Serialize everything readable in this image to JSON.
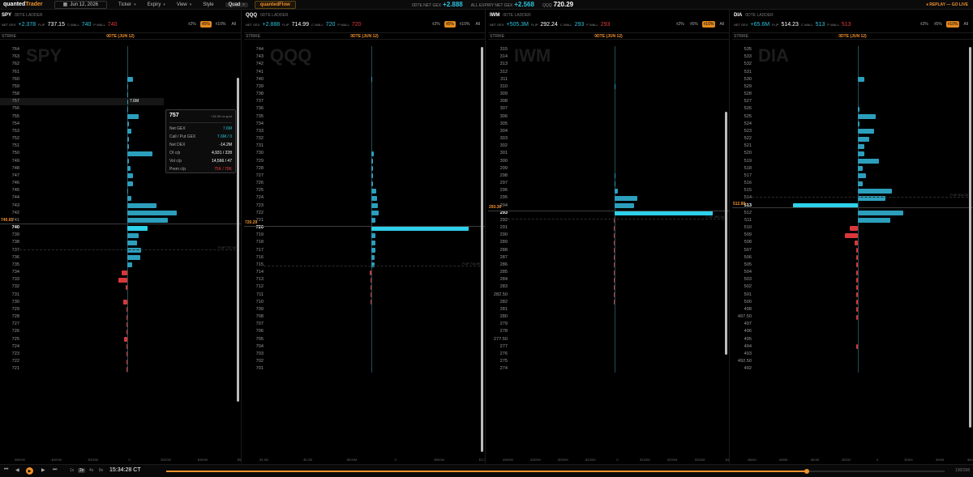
{
  "app": {
    "logo_main": "quanted",
    "logo_accent": "Trader",
    "date": "Jun 12, 2026",
    "menus": [
      "Ticker",
      "Expiry",
      "View",
      "Style"
    ],
    "layout_value": "Quad",
    "flow_button": "quantedFlow",
    "odte_label": "0DTE NET GEX",
    "odte_value": "+2.888",
    "all_label": "ALL EXPIRY NET GEX",
    "all_value": "+2.568",
    "qqq_label": "QQQ",
    "qqq_value": "720.29",
    "replay": "REPLAY — GO LIVE"
  },
  "common": {
    "subtitle": "0DTE LADDER",
    "netgex_label": "NET GEX",
    "flip_label": "FLIP",
    "cwall_label": "C WALL",
    "pwall_label": "P WALL",
    "ranges": [
      "±2%",
      "±5%",
      "±10%",
      "All"
    ],
    "strike_header": "STRIKE",
    "dte_header": "0DTE (JUN 12)"
  },
  "panels": [
    {
      "ticker": "SPY",
      "net_gex": "+2.378",
      "flip": "737.15",
      "cwall": "740",
      "pwall": "740",
      "range_sel": 1,
      "spot": 740.65,
      "spot_label": "740.65",
      "atm": 740,
      "flip_val": 737.15,
      "flip_text": "FLIP 737.15",
      "max": 500,
      "axis": [
        "-$500M",
        "-$400M",
        "-$200M",
        "0",
        "$200M",
        "$400M",
        "$5"
      ],
      "strikes": [
        764,
        763,
        762,
        761,
        760,
        759,
        758,
        757,
        756,
        755,
        754,
        753,
        752,
        751,
        750,
        749,
        748,
        747,
        746,
        745,
        744,
        743,
        742,
        741,
        740,
        739,
        738,
        737,
        736,
        735,
        734,
        733,
        732,
        731,
        730,
        729,
        728,
        727,
        726,
        725,
        724,
        723,
        722,
        721
      ],
      "gex": [
        0,
        0,
        0,
        0,
        30,
        5,
        5,
        5,
        5,
        60,
        8,
        20,
        10,
        8,
        130,
        10,
        15,
        30,
        30,
        5,
        20,
        150,
        255,
        210,
        105,
        60,
        50,
        70,
        65,
        25,
        -30,
        -45,
        -10,
        0,
        -20,
        -5,
        -3,
        -3,
        -3,
        -15,
        -3,
        -3,
        -2,
        -2
      ],
      "bar_label": {
        "strike": 757,
        "text": "7.6M"
      }
    },
    {
      "ticker": "QQQ",
      "net_gex": "+2.888",
      "flip": "714.99",
      "cwall": "720",
      "pwall": "720",
      "range_sel": 1,
      "spot": 720.29,
      "spot_label": "720.29",
      "atm": 720,
      "flip_val": 714.99,
      "flip_text": "FLIP 714.99",
      "max": 1.2,
      "axis": [
        "-$1.5B",
        "-$1.0B",
        "-$500M",
        "0",
        "$500M",
        "$1.0B"
      ],
      "strikes": [
        744,
        743,
        742,
        741,
        740,
        739,
        738,
        737,
        736,
        735,
        734,
        733,
        732,
        731,
        730,
        729,
        728,
        727,
        726,
        725,
        724,
        723,
        722,
        721,
        720,
        719,
        718,
        717,
        716,
        715,
        714,
        713,
        712,
        711,
        710,
        709,
        708,
        707,
        706,
        705,
        704,
        703,
        702,
        701
      ],
      "gex": [
        0,
        0,
        0,
        0,
        0.01,
        0,
        0,
        0,
        0,
        0,
        0,
        0,
        0,
        0,
        0.03,
        0.02,
        0.02,
        0.02,
        0.02,
        0.06,
        0.07,
        0.08,
        0.09,
        0.05,
        1.2,
        0.05,
        0.05,
        0.05,
        0.04,
        0.04,
        -0.02,
        -0.01,
        -0.01,
        -0.01,
        -0.01,
        0,
        0,
        0,
        0,
        0,
        0,
        0,
        0,
        0
      ],
      "bar_label": null
    },
    {
      "ticker": "IWM",
      "net_gex": "+505.3M",
      "flip": "292.24",
      "cwall": "293",
      "pwall": "293",
      "range_sel": 2,
      "spot": 293.3,
      "spot_label": "293.30",
      "atm": 293,
      "flip_val": 292.24,
      "flip_text": "FLIP 292.24",
      "max": 450,
      "axis": [
        "-$400M",
        "-$300M",
        "-$200M",
        "-$100M",
        "0",
        "$100M",
        "$200M",
        "$300M",
        "$4"
      ],
      "strikes": [
        "315",
        "314",
        "313",
        "312",
        "311",
        "310",
        "309",
        "308",
        "307",
        "306",
        "305",
        "304",
        "303",
        "302",
        "301",
        "300",
        "299",
        "298",
        "297",
        "296",
        "295",
        "294",
        "293",
        "292",
        "291",
        "290",
        "289",
        "288",
        "287",
        "286",
        "285",
        "284",
        "283",
        "282.50",
        "282",
        "281",
        "280",
        "279",
        "278",
        "277.50",
        "277",
        "276",
        "275",
        "274"
      ],
      "gex": [
        0,
        0,
        0,
        0,
        0,
        2,
        0,
        0,
        0,
        0,
        0,
        0,
        0,
        0,
        0,
        0,
        0,
        5,
        5,
        15,
        105,
        90,
        455,
        -3,
        -2,
        -3,
        -2,
        -2,
        -2,
        -2,
        -1,
        -1,
        -1,
        -1,
        -1,
        0,
        0,
        0,
        0,
        0,
        0,
        0,
        0,
        0
      ],
      "bar_label": null
    },
    {
      "ticker": "DIA",
      "net_gex": "+65.6M",
      "flip": "514.23",
      "cwall": "513",
      "pwall": "513",
      "range_sel": 2,
      "spot": 512.8,
      "spot_label": "512.80",
      "atm": 513,
      "flip_val": 514.23,
      "flip_text": "FLIP 514.23",
      "max": 60,
      "axis": [
        "-$60M",
        "-$50M",
        "-$40M",
        "-$20M",
        "0",
        "$20M",
        "$40M",
        "$60M"
      ],
      "strikes": [
        "535",
        "533",
        "532",
        "531",
        "530",
        "529",
        "528",
        "527",
        "526",
        "525",
        "524",
        "523",
        "522",
        "521",
        "520",
        "519",
        "518",
        "517",
        "516",
        "515",
        "514",
        "513",
        "512",
        "511",
        "510",
        "509",
        "508",
        "507",
        "506",
        "505",
        "504",
        "503",
        "502",
        "501",
        "500",
        "498",
        "497.50",
        "497",
        "496",
        "495",
        "494",
        "493",
        "492.50",
        "492"
      ],
      "gex": [
        0,
        0,
        0,
        0,
        4,
        0,
        0,
        0,
        1,
        11,
        1,
        10,
        7,
        4,
        4,
        13,
        3,
        5,
        3,
        21,
        17,
        -40,
        28,
        20,
        -5,
        -8,
        -2,
        -1,
        -1,
        -1,
        -1,
        -1,
        -1,
        -1,
        -1,
        -1,
        -1,
        0,
        0,
        0,
        -1,
        0,
        0,
        0
      ],
      "bar_label": null
    }
  ],
  "tooltip": {
    "title": "757",
    "sub": "+16.35 vs spot",
    "rows": [
      {
        "label": "Net GEX",
        "value": "7.6M",
        "cls": "b"
      },
      {
        "label": "Call / Put GEX",
        "value": "7.6M / 0",
        "cls": "b"
      },
      {
        "label": "Net DEX",
        "value": "-14.2M",
        "cls": ""
      },
      {
        "label": "OI c/p",
        "value": "4,931 / 228",
        "cls": ""
      },
      {
        "label": "Vol c/p",
        "value": "14,566 / 47",
        "cls": ""
      },
      {
        "label": "Prem c/p",
        "value": "75K / 78K",
        "cls": "r"
      }
    ]
  },
  "playback": {
    "time": "15:34:28 CT",
    "speeds": [
      "1x",
      "2x",
      "4x",
      "8x"
    ],
    "speed_sel": 1,
    "progress": 0.823,
    "position": "130/158"
  }
}
